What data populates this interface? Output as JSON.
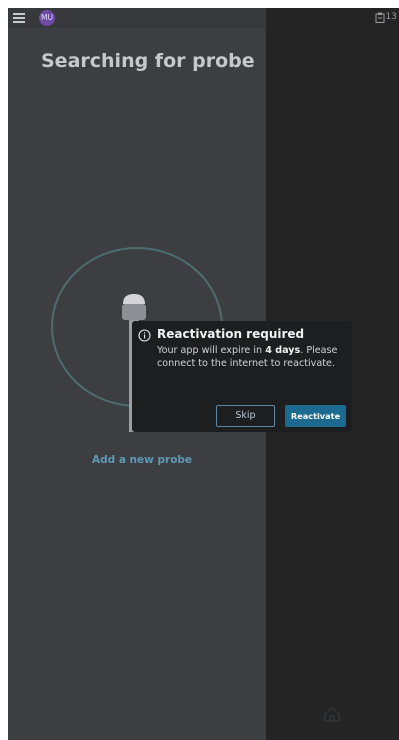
{
  "topbar": {
    "avatar_initials": "MU",
    "status_text": "13",
    "menu_icon": "hamburger-menu-icon",
    "status_icon": "clipboard-icon"
  },
  "main": {
    "title": "Searching for probe",
    "add_probe_label": "Add a new probe",
    "probe_icon": "ultrasound-probe-icon"
  },
  "dialog": {
    "title": "Reactivation required",
    "icon": "info-icon",
    "message_before": "Your app will expire in ",
    "message_days": "4 days",
    "message_after": ". Please connect to the internet to reactivate.",
    "skip_label": "Skip",
    "reactivate_label": "Reactivate"
  },
  "nav": {
    "home_icon": "home-icon"
  },
  "colors": {
    "panel_background": "#3d3e41",
    "right_panel_background": "#242425",
    "accent": "#1c6a8f",
    "link": "#5e99b8",
    "ring": "#4d6c6f",
    "avatar": "#6c4aa6"
  }
}
